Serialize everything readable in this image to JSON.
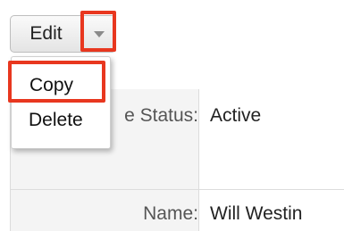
{
  "toolbar": {
    "edit_label": "Edit",
    "caret_icon": "chevron-down-icon"
  },
  "dropdown": {
    "items": [
      {
        "label": "Copy"
      },
      {
        "label": "Delete"
      }
    ]
  },
  "record": {
    "fields": [
      {
        "label": "e Status:",
        "value": "Active"
      },
      {
        "label": "Name:",
        "value": "Will Westin"
      }
    ]
  },
  "colors": {
    "highlight": "#e8371f",
    "label_column_bg": "#f4f4f4"
  }
}
